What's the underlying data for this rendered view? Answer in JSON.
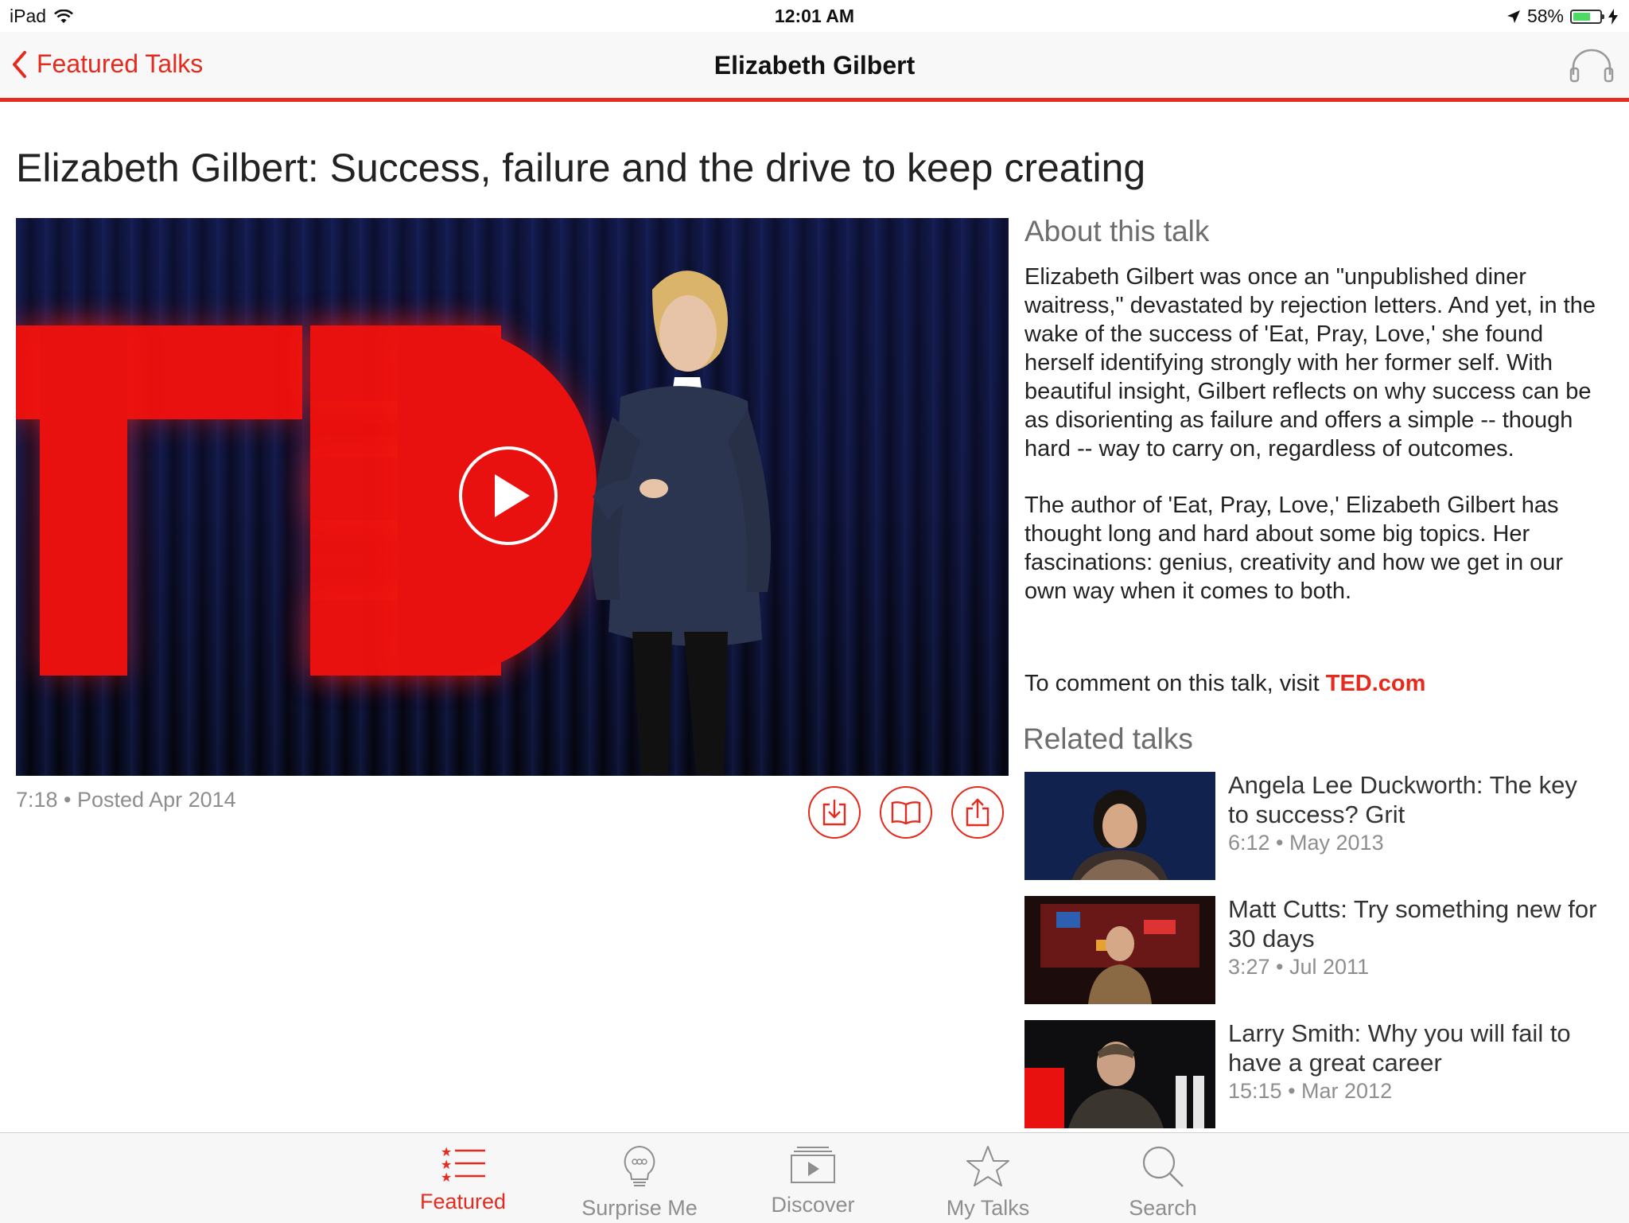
{
  "status_bar": {
    "device": "iPad",
    "time": "12:01 AM",
    "battery": "58%",
    "battery_level": 0.58
  },
  "nav": {
    "back_label": "Featured Talks",
    "title": "Elizabeth Gilbert"
  },
  "talk": {
    "title": "Elizabeth Gilbert: Success, failure and the drive to keep creating",
    "meta": "7:18 • Posted Apr 2014"
  },
  "about": {
    "heading": "About this talk",
    "paragraphs": [
      "Elizabeth Gilbert was once an \"unpublished diner waitress,\" devastated by rejection letters. And yet, in the wake of the success of 'Eat, Pray, Love,' she found herself identifying strongly with her former self. With beautiful insight, Gilbert reflects on why success can be as disorienting as failure and offers a simple -- though hard -- way to carry on, regardless of outcomes.",
      "The author of 'Eat, Pray, Love,' Elizabeth Gilbert has thought long and hard about some big topics. Her fascinations: genius, creativity and how we get in our own way when it comes to both."
    ],
    "comment_prefix": "To comment on this talk, visit ",
    "comment_link": "TED.com"
  },
  "related": {
    "heading": "Related talks",
    "items": [
      {
        "title": "Angela Lee Duckworth: The key to success? Grit",
        "meta": "6:12 • May 2013"
      },
      {
        "title": "Matt Cutts: Try something new for 30 days",
        "meta": "3:27 • Jul 2011"
      },
      {
        "title": "Larry Smith: Why you will fail to have a great career",
        "meta": "15:15 • Mar 2012"
      }
    ]
  },
  "tabs": [
    {
      "label": "Featured",
      "icon": "featured-list-icon"
    },
    {
      "label": "Surprise Me",
      "icon": "lightbulb-icon"
    },
    {
      "label": "Discover",
      "icon": "discover-icon"
    },
    {
      "label": "My Talks",
      "icon": "star-icon"
    },
    {
      "label": "Search",
      "icon": "search-icon"
    }
  ],
  "colors": {
    "accent": "#e62b1e",
    "muted_text": "#8e8e8e",
    "battery_green": "#4cd964"
  }
}
